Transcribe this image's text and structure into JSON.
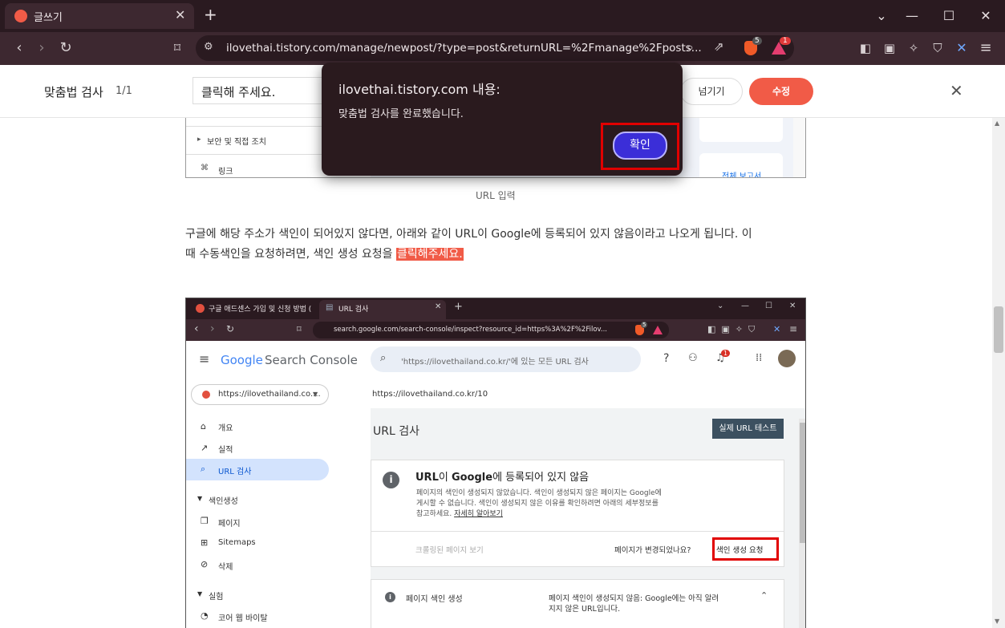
{
  "browser": {
    "tab_title": "글쓰기",
    "url": "ilovethai.tistory.com/manage/newpost/?type=post&returnURL=%2Fmanage%2Fposts...",
    "brave_badge": "5",
    "alert_badge": "1"
  },
  "spellcheck": {
    "title": "맞춤법 검사",
    "count": "1/1",
    "suggestion_value": "클릭해 주세요.",
    "skip_label": "넘기기",
    "fix_label": "수정"
  },
  "dialog": {
    "title": "ilovethai.tistory.com 내용:",
    "message": "맞춤법 검사를 완료했습니다.",
    "ok_label": "확인"
  },
  "embed1": {
    "row1": "보안 및 직접 조치",
    "row2": "링크",
    "report_link": "전체 보고서"
  },
  "article": {
    "caption": "URL 입력",
    "para_line1": "구글에 해당 주소가 색인이 되어있지 않다면, 아래와 같이 URL이 Google에 등록되어 있지 않음이라고 나오게 됩니다. 이",
    "para_line2_a": "때 수동색인을 요청하려면, 색인 생성 요청을 ",
    "para_highlight": "클릭해주세요."
  },
  "embed2": {
    "tab1": "구글 애드센스 가입 및 신청 방법 (",
    "tab2": "URL 검사",
    "url": "search.google.com/search-console/inspect?resource_id=https%3A%2F%2Filov...",
    "brave_badge": "5",
    "logo_google": "Google",
    "logo_sc": "Search Console",
    "search_placeholder": "'https://ilovethailand.co.kr/'에 있는 모든 URL 검사",
    "notif_badge": "1",
    "property": "https://ilovethailand.co....",
    "inspected_url": "https://ilovethailand.co.kr/10",
    "nav": {
      "overview": "개요",
      "performance": "실적",
      "url_inspect": "URL 검사",
      "indexing": "색인생성",
      "pages": "페이지",
      "sitemaps": "Sitemaps",
      "removals": "삭제",
      "experience": "실험",
      "cwv": "코어 웹 바이탈"
    },
    "page_title": "URL 검사",
    "live_test": "실제 URL 테스트",
    "card_title_a": "URL",
    "card_title_b": "이 ",
    "card_title_c": "Google",
    "card_title_d": "에 등록되어 있지 않음",
    "card_desc1": "페이지의 색인이 생성되지 않았습니다. 색인이 생성되지 않은 페이지는 Google에",
    "card_desc2": "게시할 수 없습니다. 색인이 생성되지 않은 이유를 확인하려면 아래의 세부정보를",
    "card_desc3": "참고하세요. ",
    "learn_more": "자세히 알아보기",
    "view_crawled": "크롤링된 페이지 보기",
    "changed_q": "페이지가 변경되었나요?",
    "request_index": "색인 생성 요청",
    "row_label": "페이지 색인 생성",
    "row_status1": "페이지 색인이 생성되지 않음: Google에는 아직 알려",
    "row_status2": "지지 않은 URL입니다."
  }
}
